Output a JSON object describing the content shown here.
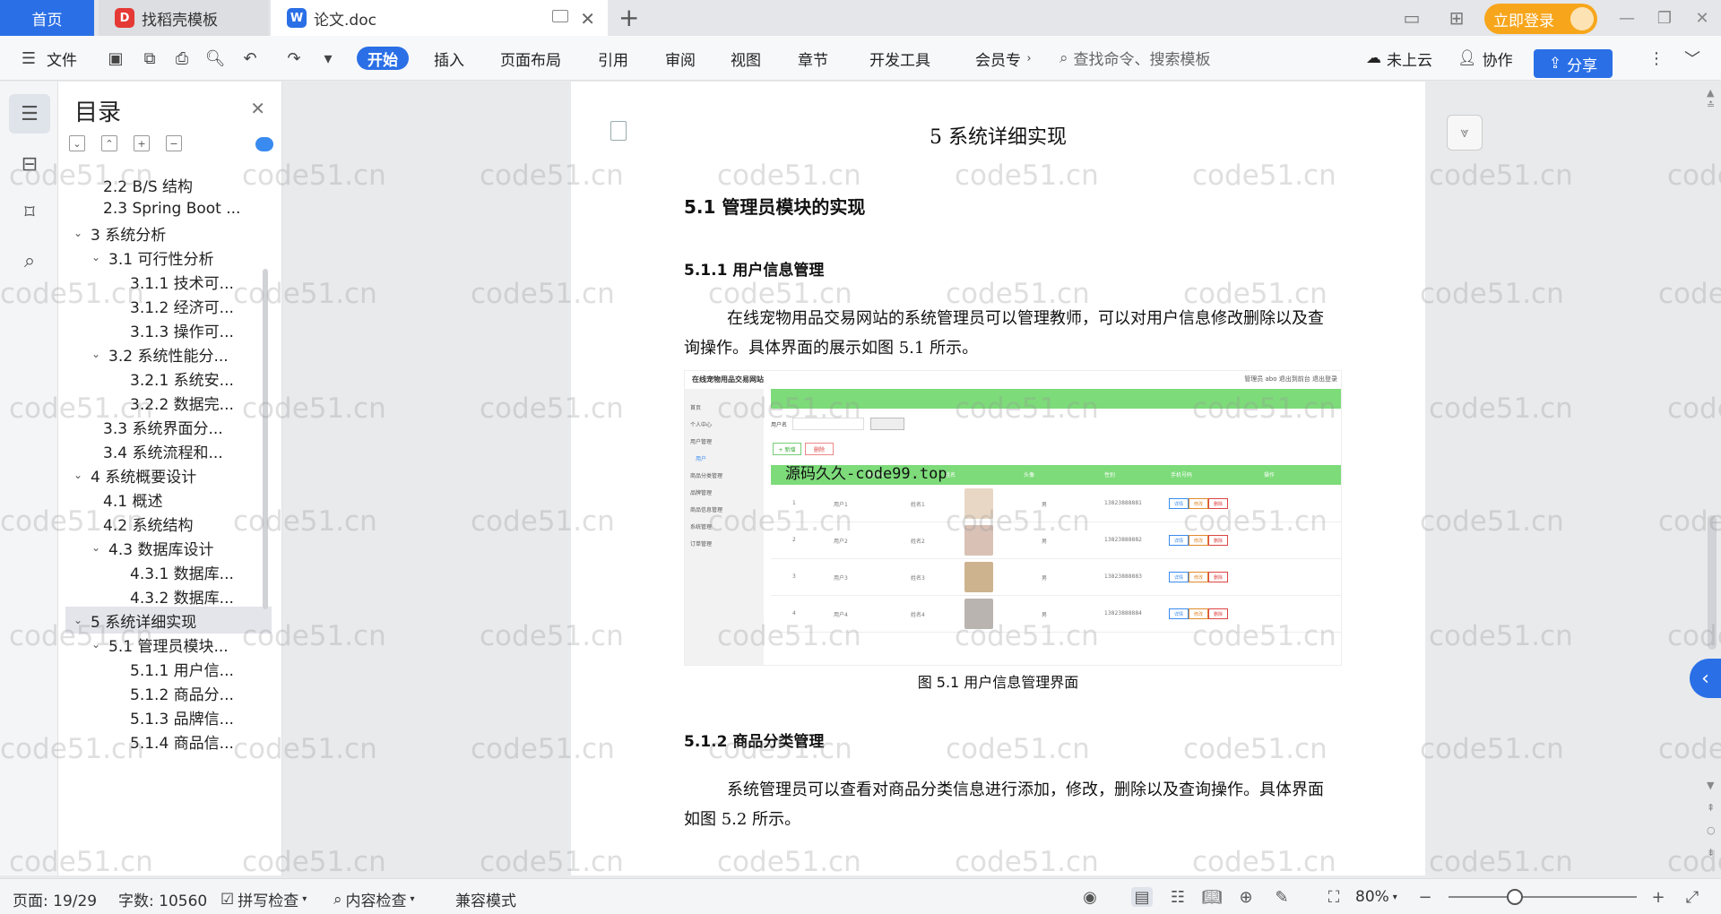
{
  "tabs": {
    "home": "首页",
    "template": "找稻壳模板",
    "doc": "论文.doc",
    "add": "+"
  },
  "titlebar": {
    "login": "立即登录"
  },
  "ribbon": {
    "file": "文件",
    "items": [
      "开始",
      "插入",
      "页面布局",
      "引用",
      "审阅",
      "视图",
      "章节",
      "开发工具",
      "会员专"
    ],
    "search_placeholder": "查找命令、搜索模板",
    "cloud": "未上云",
    "collab": "协作",
    "share": "分享"
  },
  "toc": {
    "title": "目录",
    "items": [
      {
        "label": "2.2 B/S 结构",
        "level": 2,
        "expand": ""
      },
      {
        "label": "2.3 Spring Boot ...",
        "level": 2,
        "expand": ""
      },
      {
        "label": "3 系统分析",
        "level": 1,
        "expand": "open"
      },
      {
        "label": "3.1 可行性分析",
        "level": 2,
        "expand": "open"
      },
      {
        "label": "3.1.1 技术可...",
        "level": 3,
        "expand": ""
      },
      {
        "label": "3.1.2 经济可...",
        "level": 3,
        "expand": ""
      },
      {
        "label": "3.1.3 操作可...",
        "level": 3,
        "expand": ""
      },
      {
        "label": "3.2 系统性能分...",
        "level": 2,
        "expand": "open"
      },
      {
        "label": "3.2.1 系统安...",
        "level": 3,
        "expand": ""
      },
      {
        "label": "3.2.2 数据完...",
        "level": 3,
        "expand": ""
      },
      {
        "label": "3.3 系统界面分...",
        "level": 2,
        "expand": ""
      },
      {
        "label": "3.4 系统流程和...",
        "level": 2,
        "expand": ""
      },
      {
        "label": "4 系统概要设计",
        "level": 1,
        "expand": "open"
      },
      {
        "label": "4.1 概述",
        "level": 2,
        "expand": ""
      },
      {
        "label": "4.2 系统结构",
        "level": 2,
        "expand": ""
      },
      {
        "label": "4.3 数据库设计",
        "level": 2,
        "expand": "open"
      },
      {
        "label": "4.3.1 数据库...",
        "level": 3,
        "expand": ""
      },
      {
        "label": "4.3.2 数据库...",
        "level": 3,
        "expand": ""
      },
      {
        "label": "5 系统详细实现",
        "level": 1,
        "expand": "open",
        "selected": true
      },
      {
        "label": "5.1 管理员模块...",
        "level": 2,
        "expand": "open"
      },
      {
        "label": "5.1.1 用户信...",
        "level": 3,
        "expand": ""
      },
      {
        "label": "5.1.2 商品分...",
        "level": 3,
        "expand": ""
      },
      {
        "label": "5.1.3 品牌信...",
        "level": 3,
        "expand": ""
      },
      {
        "label": "5.1.4 商品信...",
        "level": 3,
        "expand": ""
      }
    ]
  },
  "doc": {
    "chapter": "5 系统详细实现",
    "section": "5.1  管理员模块的实现",
    "sub1": "5.1.1  用户信息管理",
    "para1": "在线宠物用品交易网站的系统管理员可以管理教师，可以对用户信息修改删除以及查询操作。具体界面的展示如图 5.1 所示。",
    "figure": {
      "title": "在线宠物用品交易网站",
      "top_right": "管理员 abo   退出到前台   退出登录",
      "overlay": "源码久久-code99.top",
      "search_label": "用户名",
      "search_placeholder": "用户名",
      "add": "+ 新增",
      "delete": "删除",
      "sidebar": [
        "首页",
        "个人中心",
        "用户管理",
        "用户",
        "商品分类管理",
        "品牌管理",
        "商品信息管理",
        "系统管理",
        "订单管理"
      ],
      "headers": [
        "用户名",
        "姓名",
        "头像",
        "性别",
        "手机号码",
        "操作"
      ],
      "rows": [
        {
          "no": "1",
          "user": "用户1",
          "name": "姓名1",
          "sex": "男",
          "phone": "13823888881"
        },
        {
          "no": "2",
          "user": "用户2",
          "name": "姓名2",
          "sex": "男",
          "phone": "13823888882"
        },
        {
          "no": "3",
          "user": "用户3",
          "name": "姓名3",
          "sex": "男",
          "phone": "13823888883"
        },
        {
          "no": "4",
          "user": "用户4",
          "name": "姓名4",
          "sex": "男",
          "phone": "13823888884"
        }
      ],
      "row_actions": [
        "详情",
        "修改",
        "删除"
      ]
    },
    "caption": "图 5.1  用户信息管理界面",
    "sub2": "5.1.2  商品分类管理",
    "para2": "系统管理员可以查看对商品分类信息进行添加，修改，删除以及查询操作。具体界面如图 5.2 所示。"
  },
  "status": {
    "page": "页面: 19/29",
    "words": "字数: 10560",
    "spell": "拼写检查",
    "content": "内容检查",
    "compat": "兼容模式",
    "zoom": "80%",
    "zoom_fraction": 0.35
  },
  "watermark": "code51.cn",
  "colors": {
    "accent": "#2a6fe6",
    "login": "#f7a61c",
    "figure_green": "#7ddb7a"
  }
}
